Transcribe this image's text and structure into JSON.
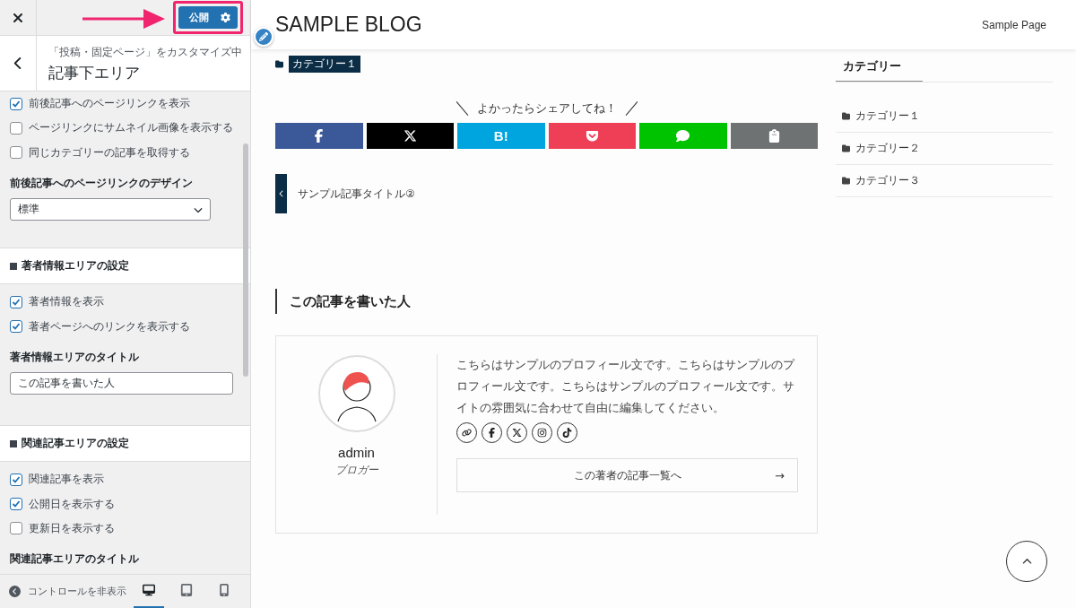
{
  "customizer": {
    "publish_button": "公開",
    "breadcrumb": "「投稿・固定ページ」をカスタマイズ中",
    "title": "記事下エリア",
    "controls": [
      {
        "kind": "checkbox",
        "label": "前後記事へのページリンクを表示",
        "checked": true
      },
      {
        "kind": "checkbox",
        "label": "ページリンクにサムネイル画像を表示する",
        "checked": false
      },
      {
        "kind": "checkbox",
        "label": "同じカテゴリーの記事を取得する",
        "checked": false
      },
      {
        "kind": "select",
        "label": "前後記事へのページリンクのデザイン",
        "value": "標準"
      },
      {
        "kind": "section",
        "label": "著者情報エリアの設定"
      },
      {
        "kind": "checkbox",
        "label": "著者情報を表示",
        "checked": true
      },
      {
        "kind": "checkbox",
        "label": "著者ページへのリンクを表示する",
        "checked": true
      },
      {
        "kind": "text",
        "label": "著者情報エリアのタイトル",
        "value": "この記事を書いた人"
      },
      {
        "kind": "section",
        "label": "関連記事エリアの設定"
      },
      {
        "kind": "checkbox",
        "label": "関連記事を表示",
        "checked": true
      },
      {
        "kind": "checkbox",
        "label": "公開日を表示する",
        "checked": true
      },
      {
        "kind": "checkbox",
        "label": "更新日を表示する",
        "checked": false
      },
      {
        "kind": "heading",
        "label": "関連記事エリアのタイトル"
      }
    ],
    "footer": {
      "hide_controls": "コントロールを非表示",
      "devices": [
        {
          "kind": "desktop",
          "selected": true
        },
        {
          "kind": "tablet",
          "selected": false
        },
        {
          "kind": "mobile",
          "selected": false
        }
      ]
    }
  },
  "preview": {
    "site_title": "SAMPLE BLOG",
    "nav": [
      "Sample Page"
    ],
    "category_tag": "カテゴリー１",
    "share": {
      "heading": "よかったらシェアしてね！",
      "buttons": [
        {
          "kind": "facebook",
          "color": "#3b5998"
        },
        {
          "kind": "x",
          "color": "#000000"
        },
        {
          "kind": "hatena",
          "color": "#00a4de",
          "label": "B!"
        },
        {
          "kind": "pocket",
          "color": "#ef3f56"
        },
        {
          "kind": "line",
          "color": "#00c300"
        },
        {
          "kind": "copy",
          "color": "#6f7273"
        }
      ]
    },
    "prev_post": "サンプル記事タイトル②",
    "author": {
      "heading": "この記事を書いた人",
      "name": "admin",
      "role": "ブロガー",
      "bio": "こちらはサンプルのプロフィール文です。こちらはサンプルのプロフィール文です。こちらはサンプルのプロフィール文です。サイトの雰囲気に合わせて自由に編集してください。",
      "socials": [
        {
          "kind": "link"
        },
        {
          "kind": "facebook"
        },
        {
          "kind": "x"
        },
        {
          "kind": "instagram"
        },
        {
          "kind": "tiktok"
        }
      ],
      "more_link": "この著者の記事一覧へ",
      "more_arrow": "→"
    },
    "widget": {
      "title": "カテゴリー",
      "items": [
        "カテゴリー１",
        "カテゴリー２",
        "カテゴリー３"
      ]
    }
  }
}
